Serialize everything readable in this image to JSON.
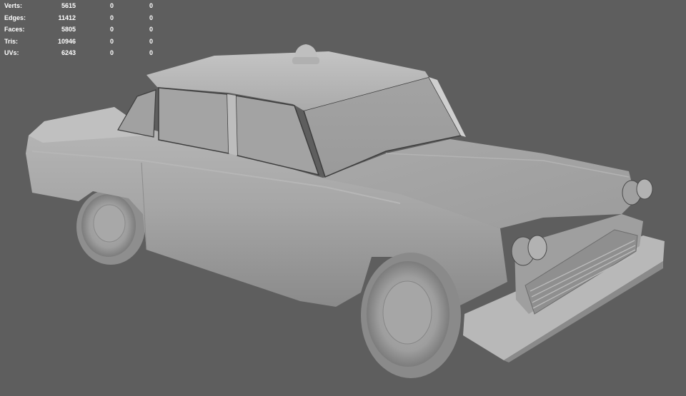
{
  "hud": {
    "rows": [
      {
        "label": "Verts:",
        "total": "5615",
        "selected": "0",
        "component": "0"
      },
      {
        "label": "Edges:",
        "total": "11412",
        "selected": "0",
        "component": "0"
      },
      {
        "label": "Faces:",
        "total": "5805",
        "selected": "0",
        "component": "0"
      },
      {
        "label": "Tris:",
        "total": "10946",
        "selected": "0",
        "component": "0"
      },
      {
        "label": "UVs:",
        "total": "6243",
        "selected": "0",
        "component": "0"
      }
    ]
  },
  "viewport": {
    "background": "#5e5e5e",
    "model": "taxi-car-mesh",
    "shading": "smooth-grey"
  }
}
